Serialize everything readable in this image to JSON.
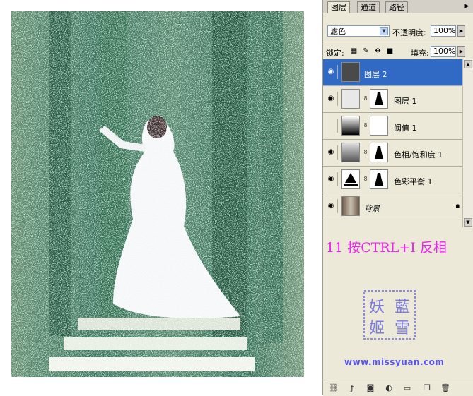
{
  "tabs": [
    {
      "label": "图层",
      "active": true
    },
    {
      "label": "通道",
      "active": false
    },
    {
      "label": "路径",
      "active": false
    }
  ],
  "blend_mode": {
    "value": "滤色"
  },
  "opacity": {
    "label": "不透明度:",
    "value": "100%"
  },
  "lock": {
    "label": "锁定:"
  },
  "fill": {
    "label": "填充:",
    "value": "100%"
  },
  "layers": [
    {
      "name": "图层 2",
      "selected": true,
      "visible": true,
      "has_mask": false
    },
    {
      "name": "图层 1",
      "selected": false,
      "visible": true,
      "has_mask": true
    },
    {
      "name": "阈值 1",
      "selected": false,
      "visible": false,
      "has_mask": true
    },
    {
      "name": "色相/饱和度 1",
      "selected": false,
      "visible": true,
      "has_mask": true
    },
    {
      "name": "色彩平衡 1",
      "selected": false,
      "visible": true,
      "has_mask": true
    },
    {
      "name": "背景",
      "selected": false,
      "visible": true,
      "has_mask": false,
      "locked": true
    }
  ],
  "step_note": "11 按CTRL+I 反相",
  "seal_text": "妖藍姬雪",
  "site": "www.missyuan.com",
  "colors": {
    "selected": "#316ac5",
    "step_text": "#ee22ee",
    "site": "#5555ee"
  }
}
